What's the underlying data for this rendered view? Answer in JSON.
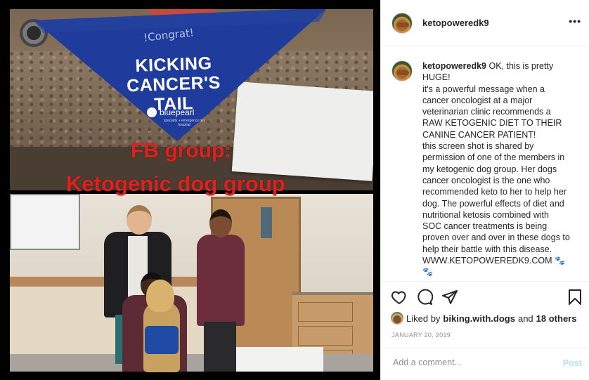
{
  "photo": {
    "bandana_congrats": "!Congrat!",
    "bandana_line1": "KICKING",
    "bandana_line2": "CANCER'S",
    "bandana_line3": "TAIL",
    "bandana_brand": "bluepearl",
    "bandana_brand_sub": "specialty + emergency pet hospital",
    "overlay_line1": "FB group:",
    "overlay_line2": "Ketogenic dog group"
  },
  "header": {
    "username": "ketopoweredk9",
    "more_label": "•••"
  },
  "caption": {
    "username": "ketopoweredk9",
    "lines": [
      "OK, this is pretty HUGE!",
      "it's a powerful message when a cancer oncologist at a major veterinarian clinic recommends a RAW KETOGENIC DIET TO THEIR CANINE CANCER PATIENT!",
      "this screen shot is shared by permission of one of the members in my ketogenic dog group. Her dogs cancer oncologist is the one who recommended keto to her to help her dog. The powerful effects of diet and nutritional ketosis combined with SOC cancer treatments is being proven over and over in these dogs to help their battle with this disease.",
      "WWW.KETOPOWEREDK9.COM"
    ],
    "emoji": "🐾"
  },
  "likes": {
    "prefix": "Liked by",
    "user": "biking.with.dogs",
    "and": "and",
    "others": "18 others"
  },
  "date": "JANUARY 20, 2019",
  "comment_box": {
    "placeholder": "Add a comment...",
    "post_label": "Post"
  },
  "icons": [
    "heart-icon",
    "comment-icon",
    "share-icon",
    "bookmark-icon",
    "more-icon"
  ]
}
